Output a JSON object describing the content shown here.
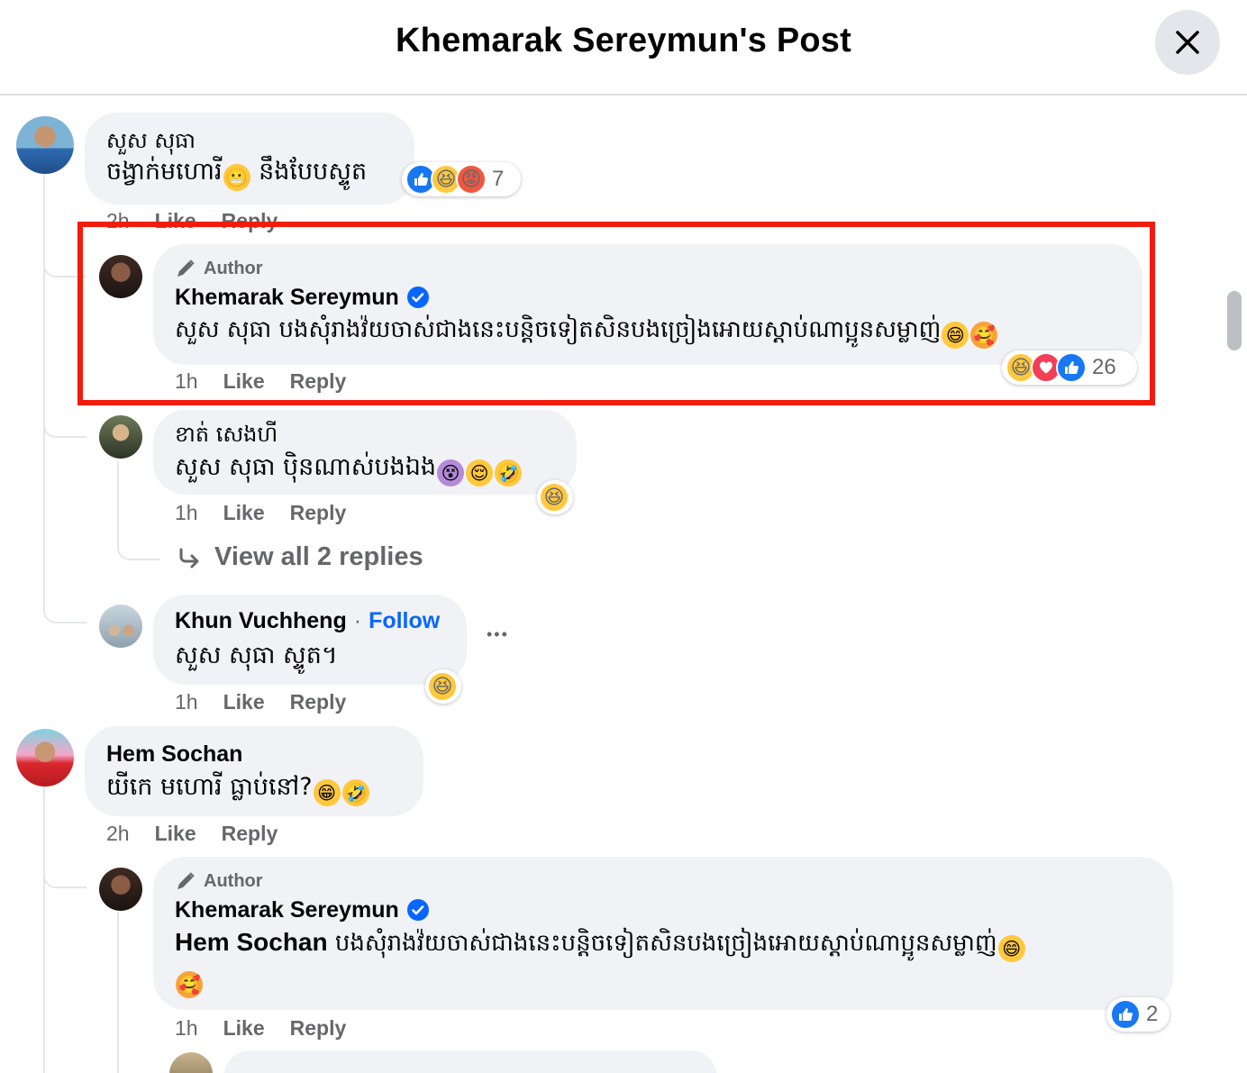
{
  "header": {
    "title": "Khemarak Sereymun's Post"
  },
  "comments": {
    "c1": {
      "name": "សួស សុធា",
      "text": "ចង្វាក់មហោរី",
      "text2": " នឹងបែបស្ទូត",
      "reaction_count": "7",
      "time": "2h",
      "like": "Like",
      "reply": "Reply"
    },
    "c2": {
      "badge": "Author",
      "name": "Khemarak Sereymun",
      "text": "សួស សុធា បងសុំរាងវ៉យចាស់ជាងនេះបន្តិចទៀតសិនបងច្រៀងអោយស្តាប់ណាប្អូនសម្លាញ់",
      "reaction_count": "26",
      "time": "1h",
      "like": "Like",
      "reply": "Reply"
    },
    "c3": {
      "name": "ខាត់ សេងហី",
      "text": "សួស សុធា ប៉ិនណាស់បងឯង",
      "time": "1h",
      "like": "Like",
      "reply": "Reply",
      "view_replies": "View all 2 replies"
    },
    "c4": {
      "name": "Khun Vuchheng",
      "sep": "·",
      "follow": "Follow",
      "text": "សួស សុធា ស្ទូត។",
      "time": "1h",
      "like": "Like",
      "reply": "Reply",
      "more": "•••"
    },
    "c5": {
      "name": "Hem Sochan",
      "text": "យីកេ មហោរី ធ្លាប់នៅ?",
      "time": "2h",
      "like": "Like",
      "reply": "Reply"
    },
    "c6": {
      "badge": "Author",
      "name": "Khemarak Sereymun",
      "mention": "Hem Sochan",
      "text": " បងសុំរាងវ៉យចាស់ជាងនេះបន្តិចទៀតសិនបងច្រៀងអោយស្តាប់ណាប្អូនសម្លាញ់",
      "reaction_count": "2",
      "time": "1h",
      "like": "Like",
      "reply": "Reply"
    }
  },
  "icons": [
    "close-icon",
    "pencil-icon",
    "verified-badge-icon",
    "like-reaction-icon",
    "haha-reaction-icon",
    "angry-reaction-icon",
    "love-reaction-icon",
    "reply-arrow-icon",
    "more-icon"
  ],
  "colors": {
    "accent": "#0866ff",
    "highlight": "#f21c0d",
    "bubble": "#f0f2f5",
    "secondary_text": "#65676b"
  }
}
